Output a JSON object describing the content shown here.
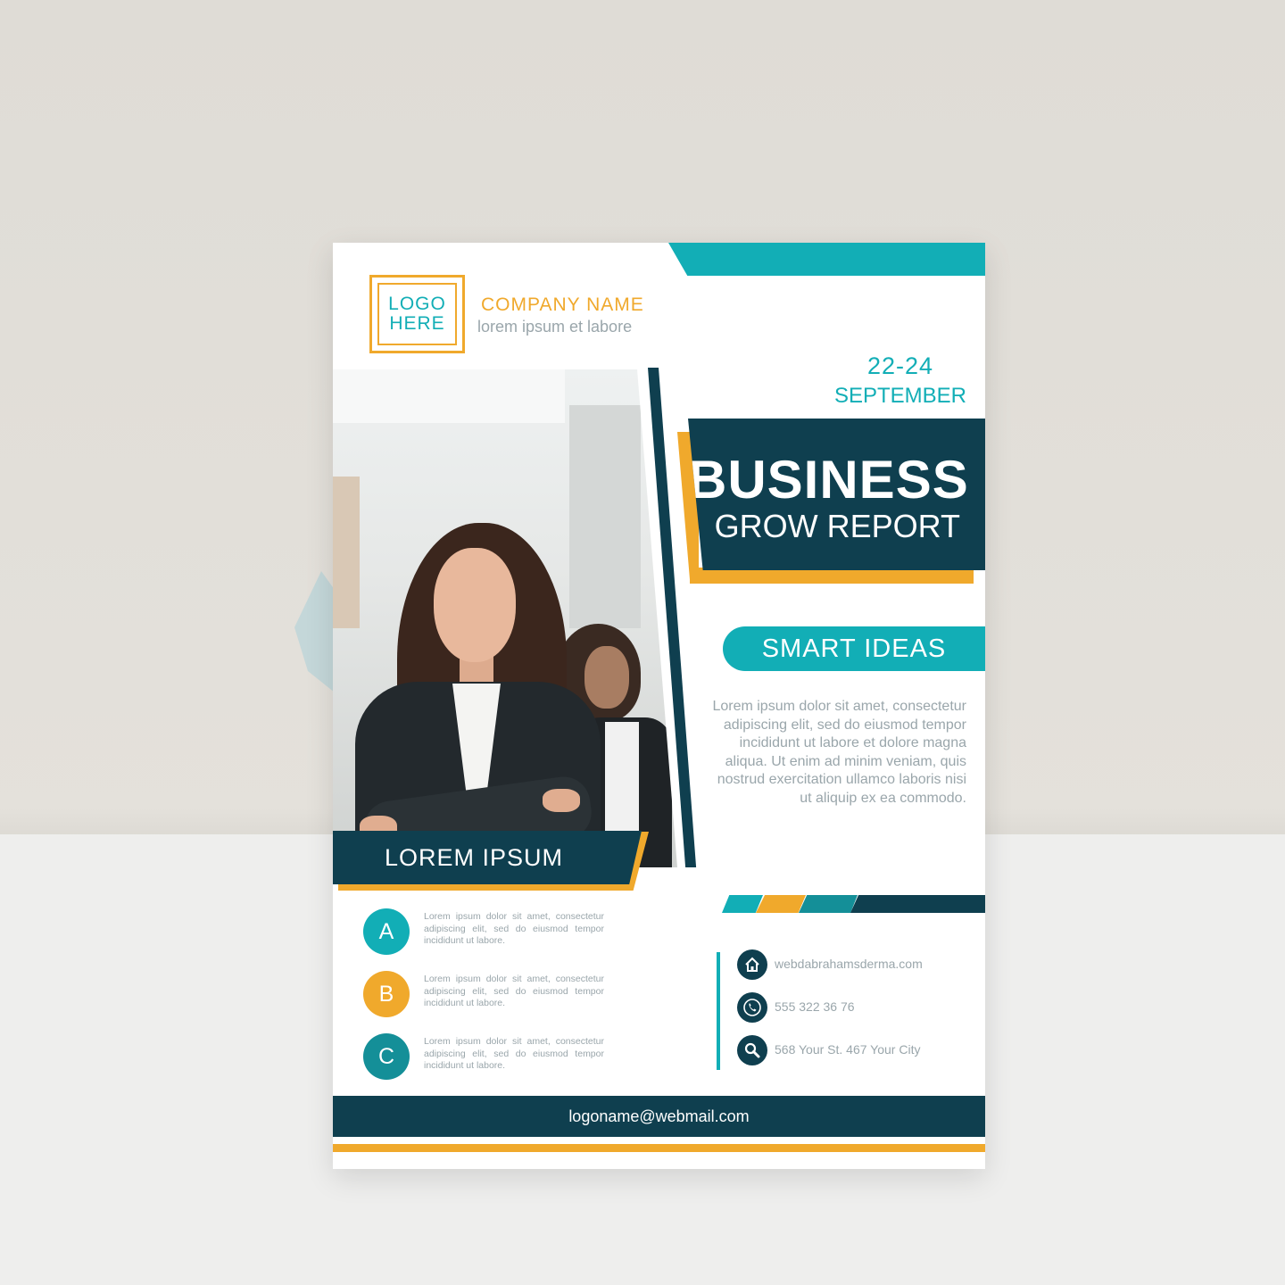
{
  "colors": {
    "teal": "#12aeb6",
    "navy": "#0f3f4f",
    "orange": "#f0a92c",
    "gray_text": "#9aa6ab"
  },
  "logo": {
    "line1": "LOGO",
    "line2": "HERE"
  },
  "company": {
    "name": "COMPANY NAME",
    "tagline": "lorem ipsum et labore"
  },
  "date": {
    "days": "22-24",
    "month": "SEPTEMBER"
  },
  "title": {
    "line1": "BUSINESS",
    "line2": "GROW REPORT"
  },
  "ideas": {
    "heading": "SMART IDEAS",
    "body": "Lorem ipsum dolor sit amet, consectetur adipiscing elit, sed do eiusmod tempor incididunt ut labore et dolore magna aliqua. Ut enim ad minim veniam, quis nostrud exercitation ullamco laboris nisi ut aliquip ex ea commodo."
  },
  "section": {
    "heading": "LOREM IPSUM"
  },
  "features": [
    {
      "letter": "A",
      "text": "Lorem ipsum dolor sit amet, consectetur adipiscing elit, sed do eiusmod tempor incididunt ut labore."
    },
    {
      "letter": "B",
      "text": "Lorem ipsum dolor sit amet, consectetur adipiscing elit, sed do eiusmod tempor incididunt ut labore."
    },
    {
      "letter": "C",
      "text": "Lorem ipsum dolor sit amet, consectetur adipiscing elit, sed do eiusmod tempor incididunt ut labore."
    }
  ],
  "contact": {
    "website": "webdabrahamsderma.com",
    "phone": "555 322 36 76",
    "address": "568 Your St. 467 Your City"
  },
  "footer": {
    "email": "logoname@webmail.com"
  },
  "icons": {
    "website": "home-icon",
    "phone": "phone-icon",
    "address": "search-icon"
  }
}
